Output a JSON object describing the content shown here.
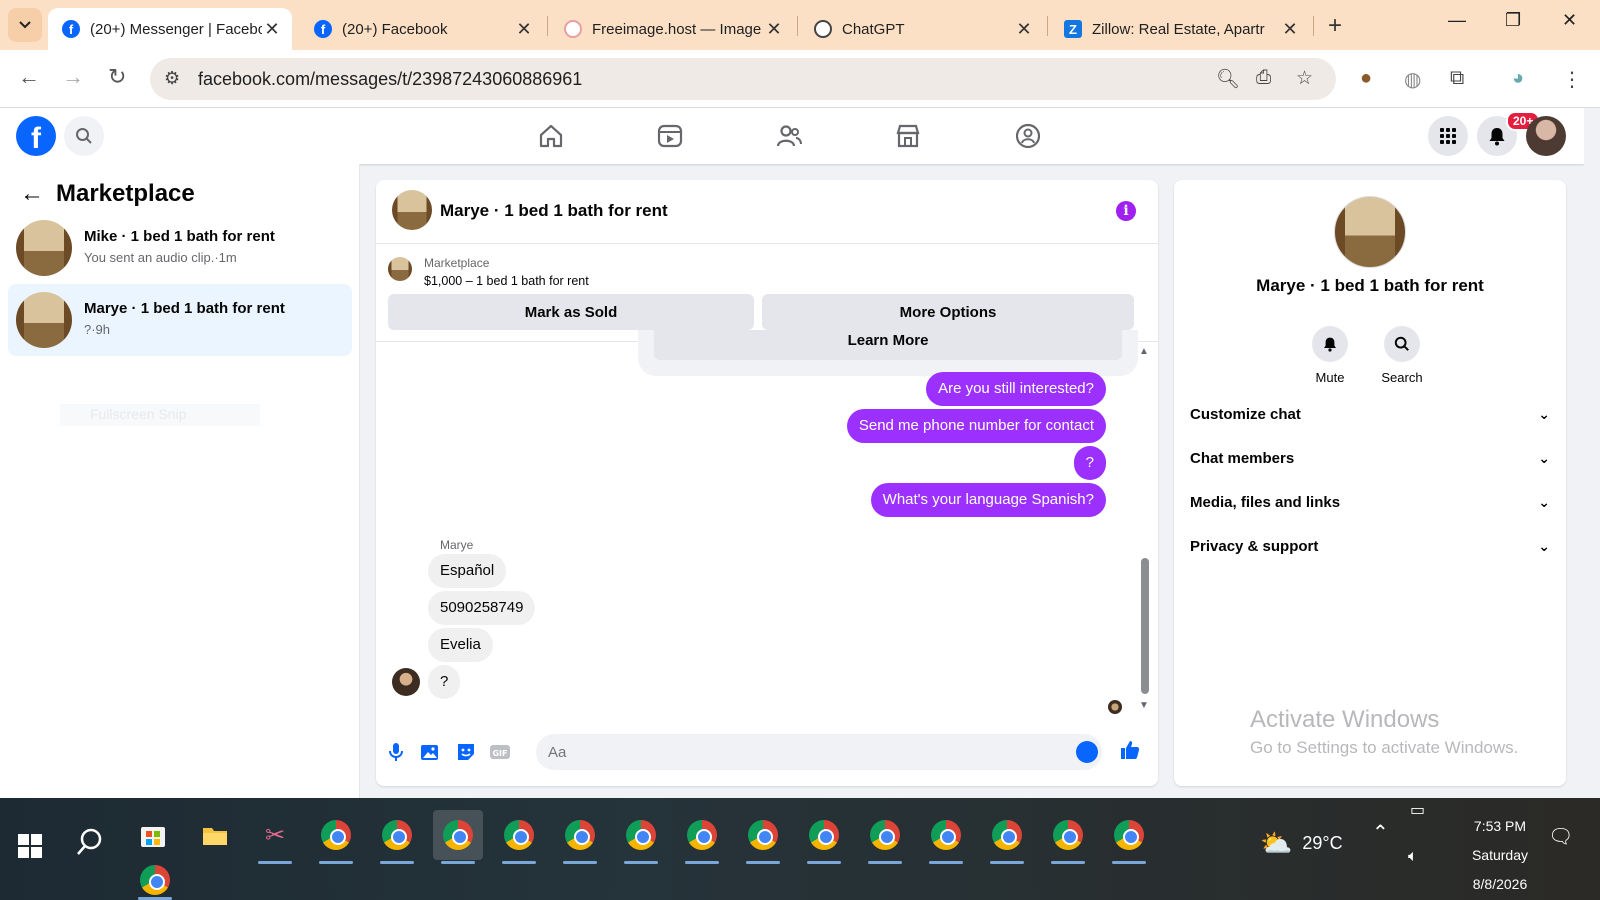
{
  "browser": {
    "tabs": [
      {
        "label": "(20+) Messenger | Facebo",
        "favicon": "facebook-icon",
        "active": true
      },
      {
        "label": "(20+) Facebook",
        "favicon": "facebook-icon",
        "active": false
      },
      {
        "label": "Freeimage.host — Image",
        "favicon": "freeimage-icon",
        "active": false
      },
      {
        "label": "ChatGPT",
        "favicon": "chatgpt-icon",
        "active": false
      },
      {
        "label": "Zillow: Real Estate, Apartr",
        "favicon": "zillow-icon",
        "active": false
      }
    ],
    "url": "facebook.com/messages/t/23987243060886961",
    "colors": {
      "tabbar": "#fbe0c6",
      "accent_purple": "#9b30ff",
      "fb_blue": "#0866ff"
    }
  },
  "fb_nav": {
    "icons": [
      "home-icon",
      "video-icon",
      "friends-icon",
      "marketplace-icon",
      "groups-icon"
    ],
    "notification_badge": "20+"
  },
  "sidebar": {
    "title": "Marketplace",
    "conversations": [
      {
        "name": "Mike · 1 bed 1 bath for rent",
        "preview": "You sent an audio clip.·1m",
        "selected": false
      },
      {
        "name": "Marye · 1 bed 1 bath for rent",
        "preview": "?·9h",
        "selected": true
      }
    ],
    "ghost_text": "Fullscreen Snip"
  },
  "chat": {
    "title": "Marye · 1 bed 1 bath for rent",
    "listing": {
      "source": "Marketplace",
      "price_line": "$1,000 – 1 bed 1 bath for rent",
      "mark_sold": "Mark as Sold",
      "more_options": "More Options"
    },
    "learn_more": "Learn More",
    "outgoing": [
      "Are you still interested?",
      "Send me phone number for contact",
      "?",
      "What's your language Spanish?"
    ],
    "sender_name": "Marye",
    "incoming": [
      "Español",
      "5090258749",
      "Evelia",
      "?"
    ],
    "composer_placeholder": "Aa"
  },
  "info_panel": {
    "name": "Marye · 1 bed 1 bath for rent",
    "mute_label": "Mute",
    "search_label": "Search",
    "sections": [
      "Customize chat",
      "Chat members",
      "Media, files and links",
      "Privacy & support"
    ]
  },
  "watermark": {
    "line1": "Activate Windows",
    "line2": "Go to Settings to activate Windows."
  },
  "taskbar": {
    "weather": "29°C",
    "time": "7:53 PM",
    "day": "Saturday",
    "date": "8/8/2026"
  }
}
